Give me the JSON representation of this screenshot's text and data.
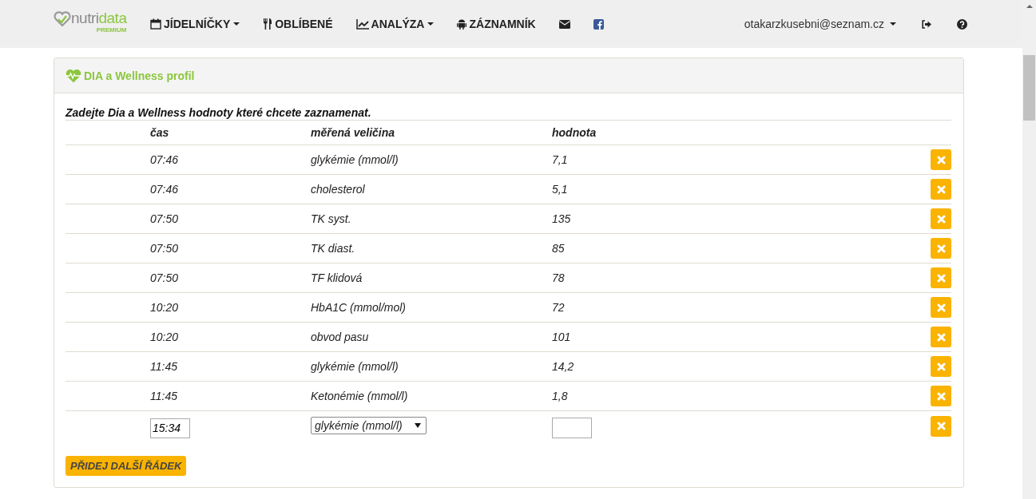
{
  "navbar": {
    "logo": {
      "text_a": "nutri",
      "text_b": "data",
      "tier": "PREMIUM"
    },
    "items": [
      {
        "label": "JÍDELNÍČKY",
        "dropdown": true
      },
      {
        "label": "OBLÍBENÉ",
        "dropdown": false
      },
      {
        "label": "ANALÝZA",
        "dropdown": true
      },
      {
        "label": "ZÁZNAMNÍK",
        "dropdown": false
      }
    ],
    "user": "otakarzkusebni@seznam.cz"
  },
  "panel": {
    "title": "DIA a Wellness profil",
    "intro": "Zadejte Dia a Wellness hodnoty které chcete zaznamenat.",
    "columns": [
      "čas",
      "měřená veličina",
      "hodnota"
    ],
    "rows": [
      {
        "time": "07:46",
        "quantity": "glykémie (mmol/l)",
        "value": "7,1"
      },
      {
        "time": "07:46",
        "quantity": "cholesterol",
        "value": "5,1"
      },
      {
        "time": "07:50",
        "quantity": "TK syst.",
        "value": "135"
      },
      {
        "time": "07:50",
        "quantity": "TK diast.",
        "value": "85"
      },
      {
        "time": "07:50",
        "quantity": "TF klidová",
        "value": "78"
      },
      {
        "time": "10:20",
        "quantity": "HbA1C (mmol/mol)",
        "value": "72"
      },
      {
        "time": "10:20",
        "quantity": "obvod pasu",
        "value": "101"
      },
      {
        "time": "11:45",
        "quantity": "glykémie (mmol/l)",
        "value": "14,2"
      },
      {
        "time": "11:45",
        "quantity": "Ketonémie (mmol/l)",
        "value": "1,8"
      }
    ],
    "new_row": {
      "time": "15:34",
      "quantity": "glykémie (mmol/l)"
    },
    "add_button": "PŘIDEJ DALŠÍ ŘÁDEK"
  }
}
